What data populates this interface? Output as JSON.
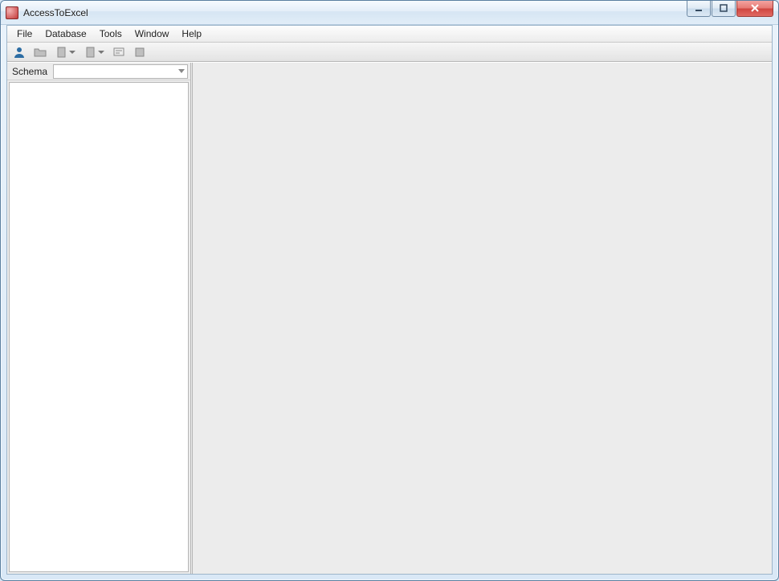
{
  "window": {
    "title": "AccessToExcel"
  },
  "menubar": {
    "items": [
      "File",
      "Database",
      "Tools",
      "Window",
      "Help"
    ]
  },
  "sidebar": {
    "schema_label": "Schema",
    "schema_value": ""
  }
}
